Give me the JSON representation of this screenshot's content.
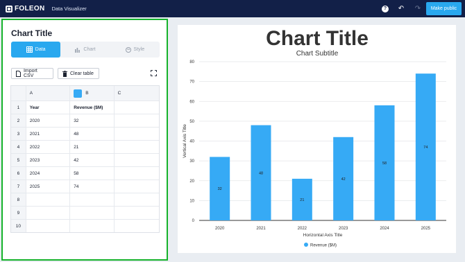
{
  "topbar": {
    "logo": "FOLEON",
    "app_title": "Data Visualizer",
    "publish_label": "Make public",
    "help_glyph": "?",
    "undo_glyph": "↶",
    "redo_glyph": "↷"
  },
  "editor": {
    "title": "Chart Title",
    "tabs": [
      {
        "label": "Data",
        "icon": "table-icon",
        "active": true
      },
      {
        "label": "Chart",
        "icon": "bar-chart-icon",
        "active": false
      },
      {
        "label": "Style",
        "icon": "palette-icon",
        "active": false
      }
    ],
    "import_label": "Import CSV",
    "clear_label": "Clear table",
    "grid": {
      "columns": [
        "A",
        "B",
        "C"
      ],
      "series_color": "#36aaf5",
      "rows": [
        {
          "n": "1",
          "a": "Year",
          "b": "Revenue ($M)",
          "c": "",
          "header": true
        },
        {
          "n": "2",
          "a": "2020",
          "b": "32",
          "c": ""
        },
        {
          "n": "3",
          "a": "2021",
          "b": "48",
          "c": ""
        },
        {
          "n": "4",
          "a": "2022",
          "b": "21",
          "c": ""
        },
        {
          "n": "5",
          "a": "2023",
          "b": "42",
          "c": ""
        },
        {
          "n": "6",
          "a": "2024",
          "b": "58",
          "c": ""
        },
        {
          "n": "7",
          "a": "2025",
          "b": "74",
          "c": ""
        },
        {
          "n": "8",
          "a": "",
          "b": "",
          "c": ""
        },
        {
          "n": "9",
          "a": "",
          "b": "",
          "c": ""
        },
        {
          "n": "10",
          "a": "",
          "b": "",
          "c": ""
        }
      ]
    }
  },
  "chart_data": {
    "type": "bar",
    "title": "Chart Title",
    "subtitle": "Chart Subtitle",
    "xlabel": "Horizontal Axis Title",
    "ylabel": "Vertical Axis Title",
    "categories": [
      "2020",
      "2021",
      "2022",
      "2023",
      "2024",
      "2025"
    ],
    "series": [
      {
        "name": "Revenue ($M)",
        "values": [
          32,
          48,
          21,
          42,
          58,
          74
        ],
        "color": "#36aaf5"
      }
    ],
    "ylim": [
      0,
      80
    ],
    "yticks": [
      0,
      10,
      20,
      30,
      40,
      50,
      60,
      70,
      80
    ],
    "grid": true,
    "legend": "bottom"
  }
}
